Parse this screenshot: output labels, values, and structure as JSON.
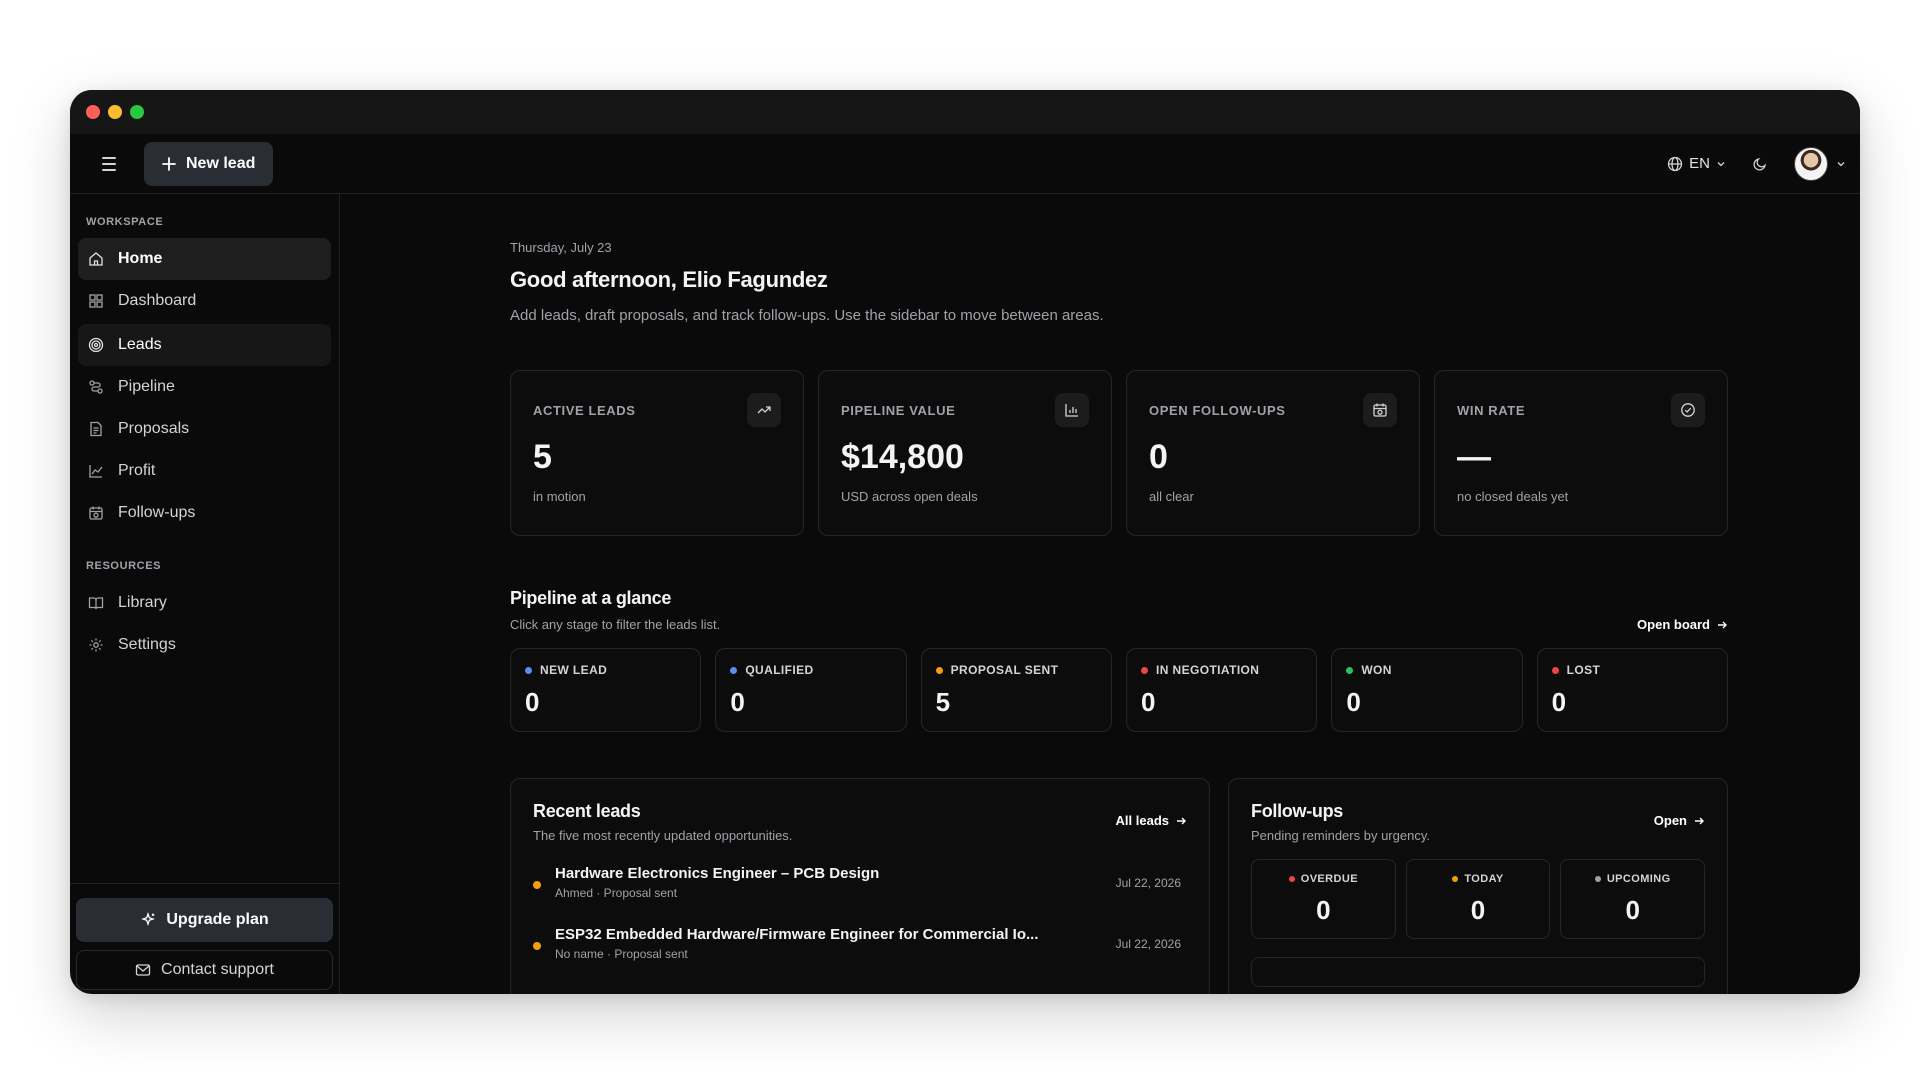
{
  "colors": {
    "close": "#ff5f57",
    "minimize": "#febc2e",
    "maximize": "#28c840",
    "stage_blue": "#5b8def",
    "stage_orange": "#f59e0b",
    "stage_red": "#ef4444",
    "stage_green": "#22c55e",
    "upcoming_gray": "#a1a1aa"
  },
  "topbar": {
    "new_lead_label": "New lead",
    "language": "EN"
  },
  "sidebar": {
    "workspace_label": "WORKSPACE",
    "workspace_items": [
      {
        "label": "Home",
        "icon": "home-icon"
      },
      {
        "label": "Dashboard",
        "icon": "grid-icon"
      },
      {
        "label": "Leads",
        "icon": "target-icon"
      },
      {
        "label": "Pipeline",
        "icon": "route-icon"
      },
      {
        "label": "Proposals",
        "icon": "document-icon"
      },
      {
        "label": "Profit",
        "icon": "line-chart-icon"
      },
      {
        "label": "Follow-ups",
        "icon": "calendar-clock-icon"
      }
    ],
    "resources_label": "RESOURCES",
    "resources_items": [
      {
        "label": "Library",
        "icon": "book-icon"
      },
      {
        "label": "Settings",
        "icon": "gear-icon"
      }
    ],
    "upgrade_label": "Upgrade plan",
    "support_label": "Contact support"
  },
  "main": {
    "date": "Thursday, July 23",
    "greeting": "Good afternoon, Elio Fagundez",
    "subtitle": "Add leads, draft proposals, and track follow-ups. Use the sidebar to move between areas.",
    "stats": [
      {
        "label": "ACTIVE LEADS",
        "value": "5",
        "sub": "in motion",
        "icon": "trending-up-icon"
      },
      {
        "label": "PIPELINE VALUE",
        "value": "$14,800",
        "sub": "USD across open deals",
        "icon": "bar-chart-icon"
      },
      {
        "label": "OPEN FOLLOW-UPS",
        "value": "0",
        "sub": "all clear",
        "icon": "calendar-clock-icon"
      },
      {
        "label": "WIN RATE",
        "value": "—",
        "sub": "no closed deals yet",
        "icon": "check-circle-icon"
      }
    ],
    "pipeline": {
      "title": "Pipeline at a glance",
      "subtitle": "Click any stage to filter the leads list.",
      "link": "Open board",
      "stages": [
        {
          "label": "NEW LEAD",
          "value": "0",
          "color": "#5b8def"
        },
        {
          "label": "QUALIFIED",
          "value": "0",
          "color": "#5b8def"
        },
        {
          "label": "PROPOSAL SENT",
          "value": "5",
          "color": "#f59e0b"
        },
        {
          "label": "IN NEGOTIATION",
          "value": "0",
          "color": "#ef4444"
        },
        {
          "label": "WON",
          "value": "0",
          "color": "#22c55e"
        },
        {
          "label": "LOST",
          "value": "0",
          "color": "#ef4444"
        }
      ]
    },
    "recent_leads": {
      "title": "Recent leads",
      "subtitle": "The five most recently updated opportunities.",
      "link": "All leads",
      "items": [
        {
          "title": "Hardware Electronics Engineer – PCB Design",
          "meta": "Ahmed · Proposal sent",
          "date": "Jul 22, 2026"
        },
        {
          "title": "ESP32 Embedded Hardware/Firmware Engineer for Commercial Io...",
          "meta": "No name · Proposal sent",
          "date": "Jul 22, 2026"
        }
      ]
    },
    "followups": {
      "title": "Follow-ups",
      "subtitle": "Pending reminders by urgency.",
      "link": "Open",
      "cards": [
        {
          "label": "OVERDUE",
          "value": "0",
          "color": "#ef4444"
        },
        {
          "label": "TODAY",
          "value": "0",
          "color": "#f59e0b"
        },
        {
          "label": "UPCOMING",
          "value": "0",
          "color": "#a1a1aa"
        }
      ]
    }
  }
}
